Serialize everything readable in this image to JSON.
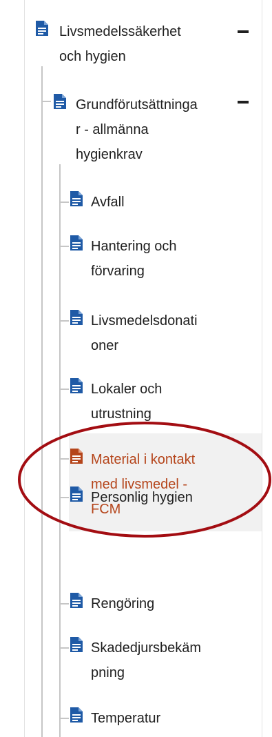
{
  "colors": {
    "icon": "#1f5aa6",
    "icon_active": "#b5451b",
    "text": "#1f1f1f",
    "text_active": "#b5451b",
    "selected_bg": "#f1f1f1",
    "annotation_ring": "#a30d12",
    "tree_line": "#c6c6c6"
  },
  "tree": {
    "root": {
      "label": "Livsmedelssäkerhet\noch hygien",
      "icon": "document-icon",
      "toggle": "collapse-minus-icon"
    },
    "child": {
      "label": "Grundförutsättninga\nr - allmänna\nhygienkrav",
      "icon": "document-icon",
      "toggle": "collapse-minus-icon"
    },
    "items": [
      {
        "label": "Avfall",
        "icon": "document-icon",
        "active": false
      },
      {
        "label": "Hantering och\nförvaring",
        "icon": "document-icon",
        "active": false
      },
      {
        "label": "Livsmedelsdonati\noner",
        "icon": "document-icon",
        "active": false
      },
      {
        "label": "Lokaler och\nutrustning",
        "icon": "document-icon",
        "active": false
      },
      {
        "label": "Material i kontakt\nmed livsmedel -\nFCM",
        "icon": "document-icon",
        "active": true
      },
      {
        "label": "Personlig hygien",
        "icon": "document-icon",
        "active": false
      },
      {
        "label": "Rengöring",
        "icon": "document-icon",
        "active": false
      },
      {
        "label": "Skadedjursbekäm\npning",
        "icon": "document-icon",
        "active": false
      },
      {
        "label": "Temperatur",
        "icon": "document-icon",
        "active": false
      }
    ]
  }
}
